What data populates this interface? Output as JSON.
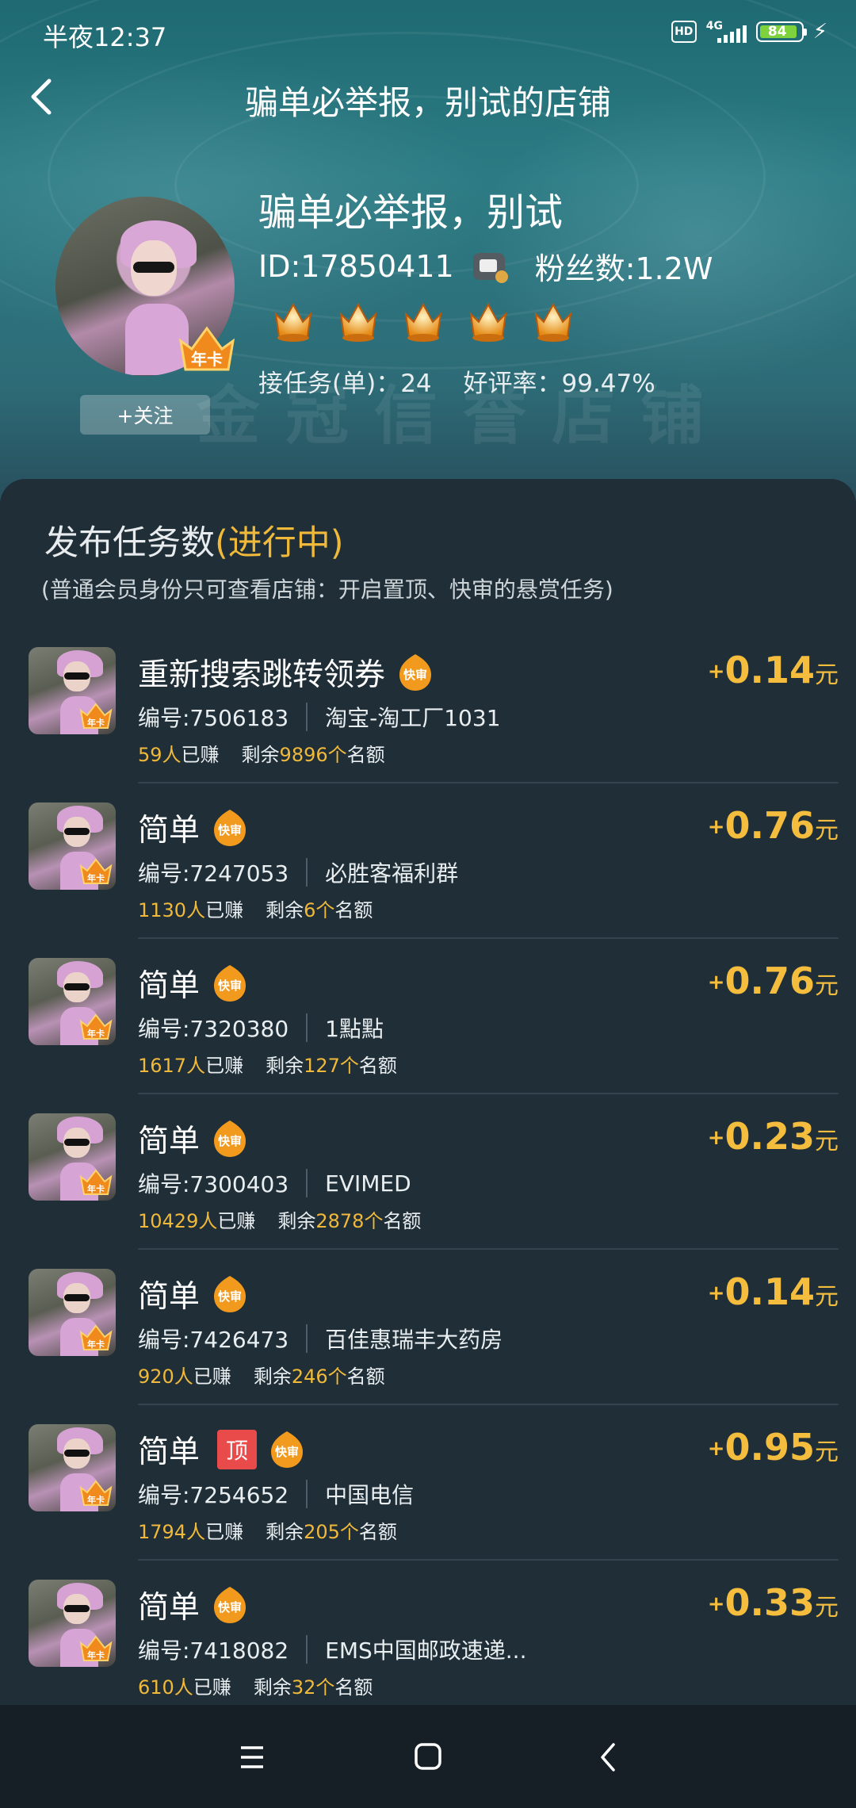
{
  "status_bar": {
    "time": "半夜12:37",
    "hd": "HD",
    "network": "4G",
    "battery": "84"
  },
  "nav": {
    "title": "骗单必举报，别试的店铺"
  },
  "shop": {
    "name": "骗单必举报，别试",
    "id": "ID:17850411",
    "fans": "粉丝数:1.2W",
    "year_badge": "年卡",
    "follow_label": "+关注",
    "tasks_label": "接任务(单)：24",
    "rating_label": "好评率：99.47%",
    "watermark": "金冠信誉店铺",
    "crown_count": 5
  },
  "section": {
    "title": "发布任务数",
    "status": "(进行中)",
    "subtitle": "(普通会员身份只可查看店铺：开启置顶、快审的悬赏任务)"
  },
  "tags": {
    "fast": "快审",
    "top": "顶"
  },
  "labels": {
    "earned_suffix": "已赚",
    "remaining_prefix": "剩余",
    "remaining_suffix": "名额",
    "currency": "元",
    "plus": "+"
  },
  "tasks": [
    {
      "title": "重新搜索跳转领券",
      "code": "编号:7506183",
      "store": "淘宝-淘工厂1031",
      "earned": "59人",
      "remaining": "9896个",
      "price": "0.14",
      "top": false
    },
    {
      "title": "简单",
      "code": "编号:7247053",
      "store": "必胜客福利群",
      "earned": "1130人",
      "remaining": "6个",
      "price": "0.76",
      "top": false
    },
    {
      "title": "简单",
      "code": "编号:7320380",
      "store": "1點點",
      "earned": "1617人",
      "remaining": "127个",
      "price": "0.76",
      "top": false
    },
    {
      "title": "简单",
      "code": "编号:7300403",
      "store": "EVIMED",
      "earned": "10429人",
      "remaining": "2878个",
      "price": "0.23",
      "top": false
    },
    {
      "title": "简单",
      "code": "编号:7426473",
      "store": "百佳惠瑞丰大药房",
      "earned": "920人",
      "remaining": "246个",
      "price": "0.14",
      "top": false
    },
    {
      "title": "简单",
      "code": "编号:7254652",
      "store": "中国电信",
      "earned": "1794人",
      "remaining": "205个",
      "price": "0.95",
      "top": true
    },
    {
      "title": "简单",
      "code": "编号:7418082",
      "store": "EMS中国邮政速递...",
      "earned": "610人",
      "remaining": "32个",
      "price": "0.33",
      "top": false
    }
  ]
}
